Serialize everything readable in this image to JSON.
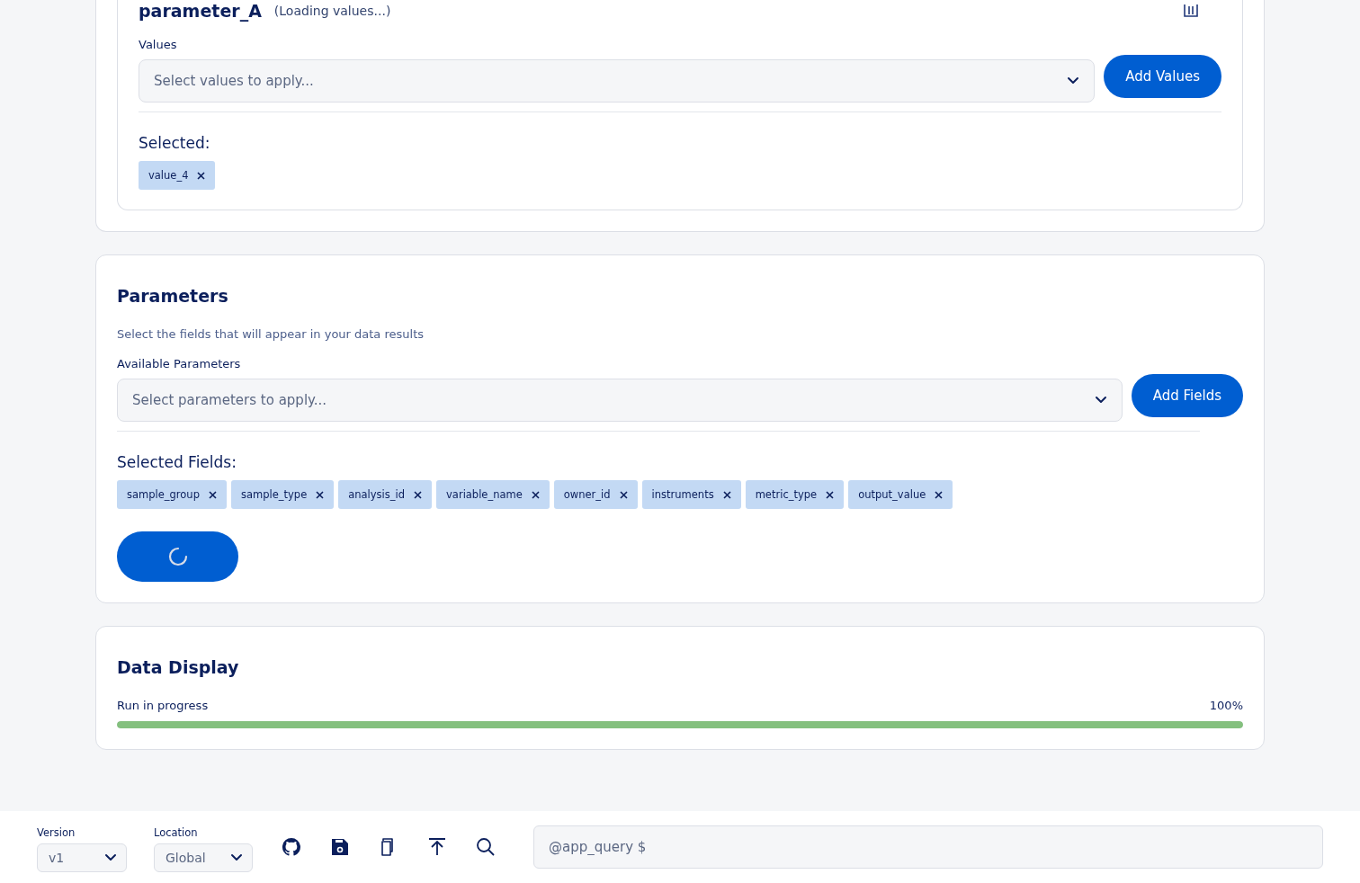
{
  "filter_card": {
    "title": "parameter_A",
    "status": "(Loading values...)",
    "values_label": "Values",
    "select_placeholder": "Select values to apply...",
    "add_button": "Add Values",
    "selected_label": "Selected:",
    "chips": [
      "value_4"
    ]
  },
  "parameters": {
    "title": "Parameters",
    "subtitle": "Select the fields that will appear in your data results",
    "available_label": "Available Parameters",
    "select_placeholder": "Select parameters to apply...",
    "add_button": "Add Fields",
    "selected_label": "Selected Fields:",
    "chips": [
      "sample_group",
      "sample_type",
      "analysis_id",
      "variable_name",
      "owner_id",
      "instruments",
      "metric_type",
      "output_value"
    ],
    "run_button": {
      "loading": true
    }
  },
  "data_display": {
    "title": "Data Display",
    "progress_label": "Run in progress",
    "reading": "100%",
    "level": 1
  },
  "footer": {
    "version": {
      "label": "Version",
      "value": "v1"
    },
    "location": {
      "label": "Location",
      "value": "Global"
    },
    "query_placeholder": "@app_query $"
  }
}
